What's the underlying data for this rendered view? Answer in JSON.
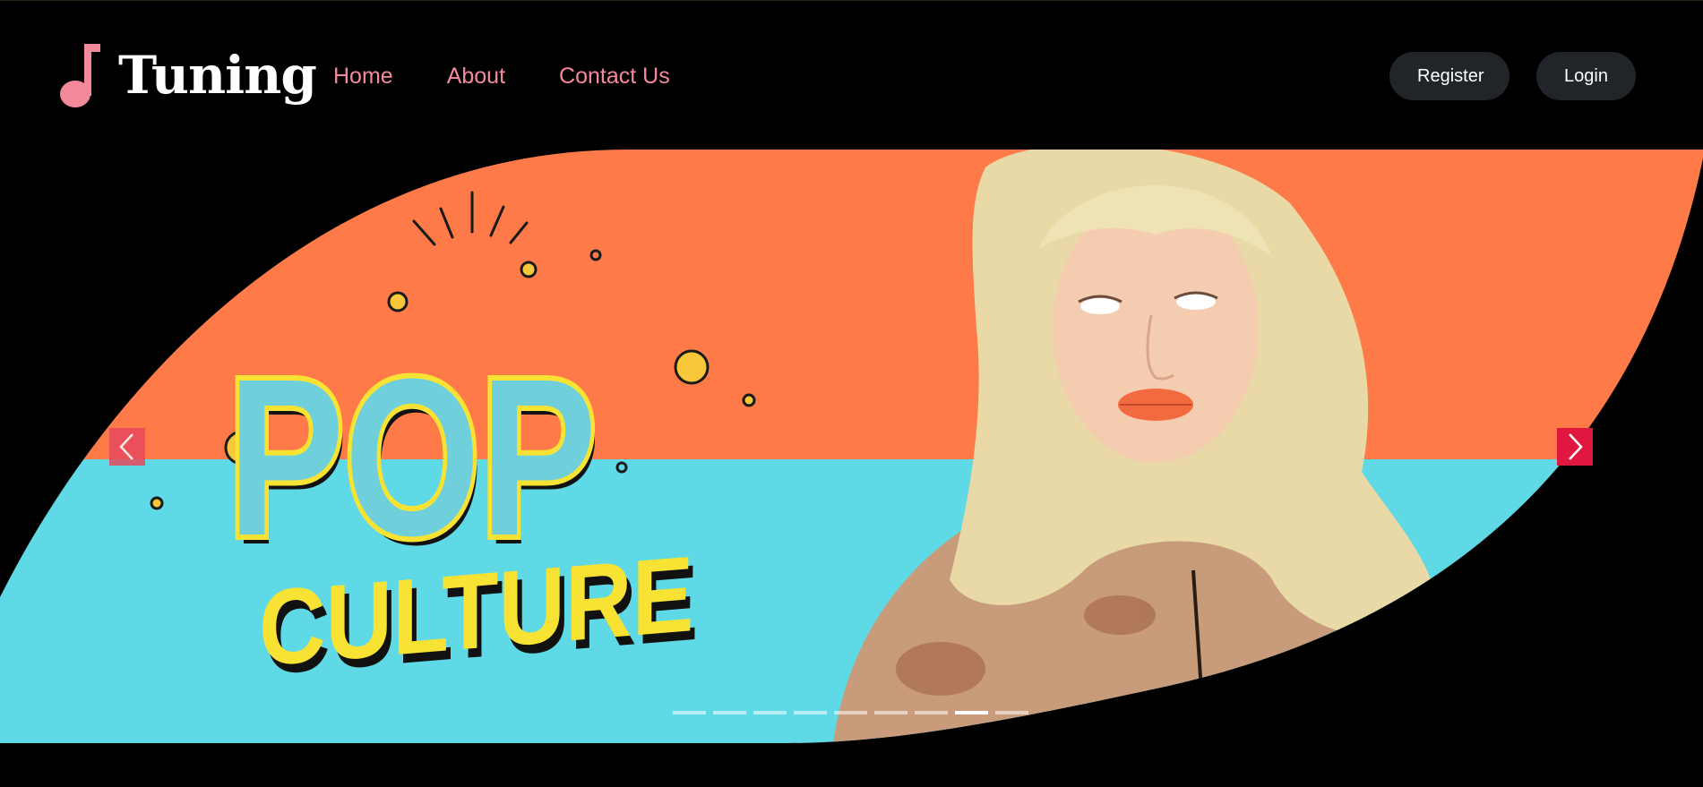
{
  "navbar": {
    "brand": {
      "name": "Tuning",
      "icon": "music-note-icon"
    },
    "links": [
      {
        "label": "Home"
      },
      {
        "label": "About"
      },
      {
        "label": "Contact Us"
      }
    ],
    "actions": {
      "register_label": "Register",
      "login_label": "Login"
    }
  },
  "carousel": {
    "slide_title_line1": "POP",
    "slide_title_line2": "CULTURE",
    "prev_icon": "chevron-left-icon",
    "next_icon": "chevron-right-icon",
    "indicator_count": 9,
    "active_indicator": 8
  },
  "colors": {
    "background": "#000000",
    "nav_link": "#f4899b",
    "button_bg": "#212529",
    "orange": "#fe7a48",
    "cyan": "#5ed9e5",
    "title_yellow": "#f8e334",
    "control_red": "#e0183f"
  }
}
